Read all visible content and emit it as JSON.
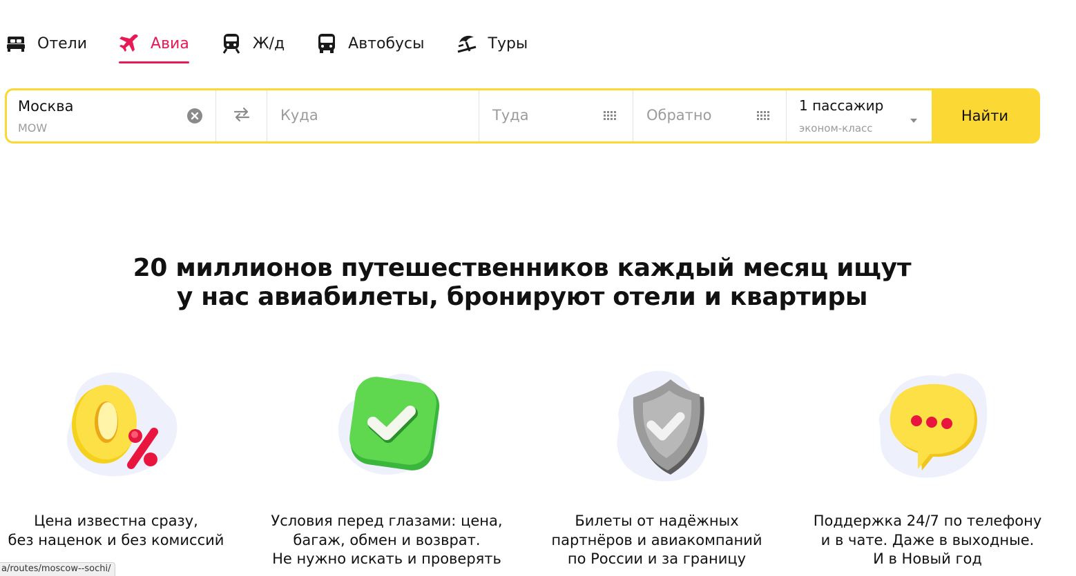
{
  "tabs": [
    {
      "label": "Отели",
      "icon": "bed-icon",
      "active": false
    },
    {
      "label": "Авиа",
      "icon": "plane-icon",
      "active": true
    },
    {
      "label": "Ж/д",
      "icon": "train-icon",
      "active": false
    },
    {
      "label": "Автобусы",
      "icon": "bus-icon",
      "active": false
    },
    {
      "label": "Туры",
      "icon": "beach-umbrella-icon",
      "active": false
    }
  ],
  "search": {
    "from_value": "Москва",
    "from_code": "MOW",
    "to_placeholder": "Куда",
    "there_placeholder": "Туда",
    "back_placeholder": "Обратно",
    "passengers": "1 пассажир",
    "class": "эконом-класс",
    "find_label": "Найти"
  },
  "headline": {
    "line1": "20 миллионов путешественников каждый месяц ищут",
    "line2": "у нас авиабилеты, бронируют отели и квартиры"
  },
  "features": [
    {
      "icon": "zero-percent-icon",
      "lines": [
        "Цена известна сразу,",
        "без наценок и без комиссий"
      ]
    },
    {
      "icon": "checkmark-icon",
      "lines": [
        "Условия перед глазами: цена,",
        "багаж, обмен и возврат.",
        "Не нужно искать и проверять"
      ]
    },
    {
      "icon": "shield-icon",
      "lines": [
        "Билеты от надёжных",
        "партнёров и авиакомпаний",
        "по России и за границу"
      ]
    },
    {
      "icon": "chat-bubble-icon",
      "lines": [
        "Поддержка 24/7 по телефону",
        "и в чате. Даже в выходные.",
        "И в Новый год"
      ]
    }
  ],
  "status_url": "a/routes/moscow--sochi/",
  "colors": {
    "accent": "#e61b55",
    "button": "#fbd833",
    "placeholder": "#9b9b9b"
  }
}
